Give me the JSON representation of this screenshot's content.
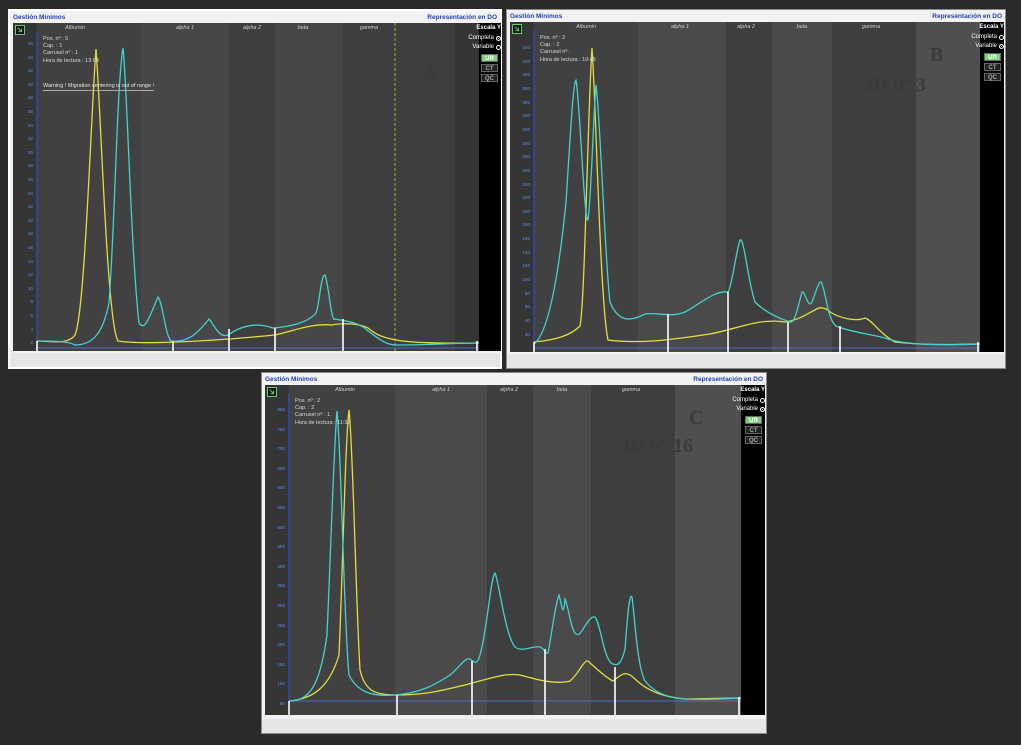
{
  "panels": [
    {
      "id": "A",
      "title_left": "Gestión Mínimos",
      "title_right": "Representación en DO",
      "info": {
        "pos": "Pos. nº : 5",
        "cap": "Cap. : 1",
        "carrusel": "Carrusel nº : 1",
        "hora": "Hora de lectura : 13:04"
      },
      "warning": "Warning !  Migration centering is out of range !",
      "fractions": [
        "Albumin",
        "alpha 1",
        "alpha 2",
        "beta",
        "gamma"
      ],
      "yticks": [
        "46",
        "44",
        "42",
        "40",
        "38",
        "36",
        "34",
        "32",
        "30",
        "28",
        "26",
        "24",
        "22",
        "20",
        "18",
        "16",
        "14",
        "12",
        "10",
        "8",
        "6",
        "4",
        "2"
      ],
      "scale": {
        "title": "Escala Y",
        "completa": "Completa",
        "variable": "Variable"
      },
      "buttons": {
        "ur": "UR",
        "ct": "CT",
        "qc": "QC"
      },
      "letter": "A",
      "id_label": ""
    },
    {
      "id": "B",
      "title_left": "Gestión Mínimos",
      "title_right": "Representación en DO",
      "info": {
        "pos": "Pos. nº : 2",
        "cap": "Cap. : 2",
        "carrusel": "Carrusel nº :",
        "hora": "Hora de lectura : 10:45"
      },
      "warning": "",
      "fractions": [
        "Albumin",
        "alpha 1",
        "alpha 2",
        "beta",
        "gamma"
      ],
      "yticks": [
        "440",
        "420",
        "400",
        "380",
        "360",
        "340",
        "320",
        "300",
        "280",
        "260",
        "240",
        "220",
        "200",
        "180",
        "160",
        "140",
        "120",
        "100",
        "80",
        "60",
        "40",
        "20"
      ],
      "scale": {
        "title": "Escala Y",
        "completa": "Completa",
        "variable": "Variable"
      },
      "buttons": {
        "ur": "UR",
        "ct": "CT",
        "qc": "QC"
      },
      "letter": "B",
      "id_label": "ID nº 3"
    },
    {
      "id": "C",
      "title_left": "Gestión Mínimos",
      "title_right": "Representación en DO",
      "info": {
        "pos": "Pos. nº : 2",
        "cap": "Cap. : 2",
        "carrusel": "Carrusel nº : 1",
        "hora": "Hora de lectura : 11:37"
      },
      "warning": "",
      "fractions": [
        "Albumin",
        "alpha 1",
        "alpha 2",
        "beta",
        "gamma"
      ],
      "yticks": [
        "800",
        "750",
        "700",
        "650",
        "600",
        "550",
        "500",
        "450",
        "400",
        "350",
        "300",
        "250",
        "200",
        "150",
        "100",
        "50"
      ],
      "scale": {
        "title": "Escala Y",
        "completa": "Completa",
        "variable": "Variable"
      },
      "buttons": {
        "ur": "UR",
        "ct": "CT",
        "qc": "QC"
      },
      "letter": "C",
      "id_label": "ID nº 16"
    }
  ]
}
